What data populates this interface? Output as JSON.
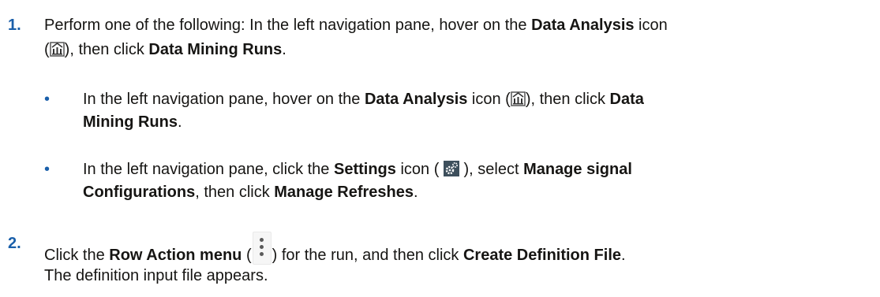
{
  "steps": [
    {
      "number": "1.",
      "line1_a": "Perform one of the following: In the left navigation pane, hover on the ",
      "line1_b": "Data Analysis",
      "line1_c": " icon",
      "line2_a": "(",
      "line2_b": "), then click ",
      "line2_c": "Data Mining Runs",
      "line2_d": ".",
      "bullets": [
        {
          "line1_a": "In the left navigation pane, hover on the ",
          "line1_b": "Data Analysis",
          "line1_c": " icon (",
          "line1_d": "), then click ",
          "line1_e": "Data",
          "line2_a": "Mining Runs",
          "line2_b": "."
        },
        {
          "line1_a": "In the left navigation pane, click the ",
          "line1_b": "Settings",
          "line1_c": " icon ( ",
          "line1_d": " ), select ",
          "line1_e": "Manage signal",
          "line2_a": "Configurations",
          "line2_b": ", then click ",
          "line2_c": "Manage Refreshes",
          "line2_d": "."
        }
      ]
    },
    {
      "number": "2.",
      "line1_a": "Click the ",
      "line1_b": "Row Action menu",
      "line1_c": " (",
      "line1_d": ") for the run, and then click ",
      "line1_e": "Create Definition File",
      "line1_f": ".",
      "result": "The definition input file appears."
    }
  ],
  "bullet_glyph": "•",
  "icons": [
    "data-analysis-icon",
    "settings-gear-icon",
    "row-action-kebab-icon"
  ],
  "colors": {
    "text": "#161513",
    "accent": "#1a5faa"
  }
}
